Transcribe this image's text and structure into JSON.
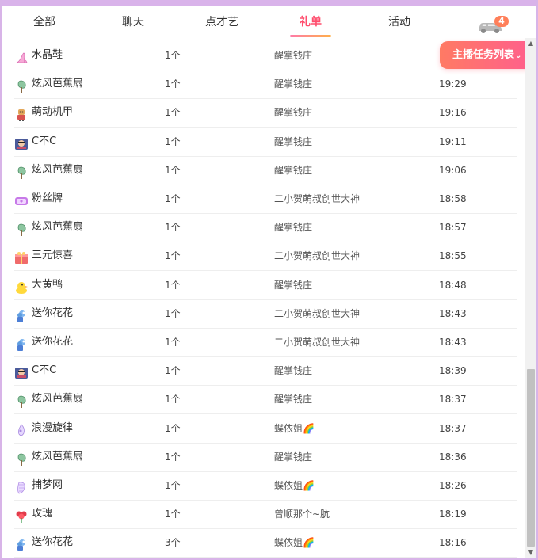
{
  "tabs": [
    {
      "label": "全部",
      "active": false
    },
    {
      "label": "聊天",
      "active": false
    },
    {
      "label": "点才艺",
      "active": false
    },
    {
      "label": "礼单",
      "active": true
    },
    {
      "label": "活动",
      "active": false
    }
  ],
  "car_badge": "4",
  "task_button": {
    "label": "主播任务列表",
    "chevron": "⌄"
  },
  "gifts": [
    {
      "name": "水晶鞋",
      "icon": "shoe",
      "qty": "1个",
      "user": "醒掌钱庄",
      "time": ""
    },
    {
      "name": "炫风芭蕉扇",
      "icon": "fan",
      "qty": "1个",
      "user": "醒掌钱庄",
      "time": "19:29"
    },
    {
      "name": "萌动机甲",
      "icon": "mecha",
      "qty": "1个",
      "user": "醒掌钱庄",
      "time": "19:16"
    },
    {
      "name": "C不C",
      "icon": "card",
      "qty": "1个",
      "user": "醒掌钱庄",
      "time": "19:11"
    },
    {
      "name": "炫风芭蕉扇",
      "icon": "fan",
      "qty": "1个",
      "user": "醒掌钱庄",
      "time": "19:06"
    },
    {
      "name": "粉丝牌",
      "icon": "fanbadge",
      "qty": "1个",
      "user": "二小贺萌叔创世大神",
      "time": "18:58"
    },
    {
      "name": "炫风芭蕉扇",
      "icon": "fan",
      "qty": "1个",
      "user": "醒掌钱庄",
      "time": "18:57"
    },
    {
      "name": "三元惊喜",
      "icon": "gift",
      "qty": "1个",
      "user": "二小贺萌叔创世大神",
      "time": "18:55"
    },
    {
      "name": "大黄鸭",
      "icon": "duck",
      "qty": "1个",
      "user": "醒掌钱庄",
      "time": "18:48"
    },
    {
      "name": "送你花花",
      "icon": "flower",
      "qty": "1个",
      "user": "二小贺萌叔创世大神",
      "time": "18:43"
    },
    {
      "name": "送你花花",
      "icon": "flower",
      "qty": "1个",
      "user": "二小贺萌叔创世大神",
      "time": "18:43"
    },
    {
      "name": "C不C",
      "icon": "card",
      "qty": "1个",
      "user": "醒掌钱庄",
      "time": "18:39"
    },
    {
      "name": "炫风芭蕉扇",
      "icon": "fan",
      "qty": "1个",
      "user": "醒掌钱庄",
      "time": "18:37"
    },
    {
      "name": "浪漫旋律",
      "icon": "melody",
      "qty": "1个",
      "user": "蝶依姐🌈",
      "time": "18:37"
    },
    {
      "name": "炫风芭蕉扇",
      "icon": "fan",
      "qty": "1个",
      "user": "醒掌钱庄",
      "time": "18:36"
    },
    {
      "name": "捕梦网",
      "icon": "dreamnet",
      "qty": "1个",
      "user": "蝶依姐🌈",
      "time": "18:26"
    },
    {
      "name": "玫瑰",
      "icon": "rose",
      "qty": "1个",
      "user": "曾顺那个~肮",
      "time": "18:19"
    },
    {
      "name": "送你花花",
      "icon": "flower",
      "qty": "3个",
      "user": "蝶依姐🌈",
      "time": "18:16"
    }
  ],
  "colors": {
    "accent": "#ff4d6d",
    "border": "#d9b3ea",
    "badge": "#ff7f5a"
  }
}
